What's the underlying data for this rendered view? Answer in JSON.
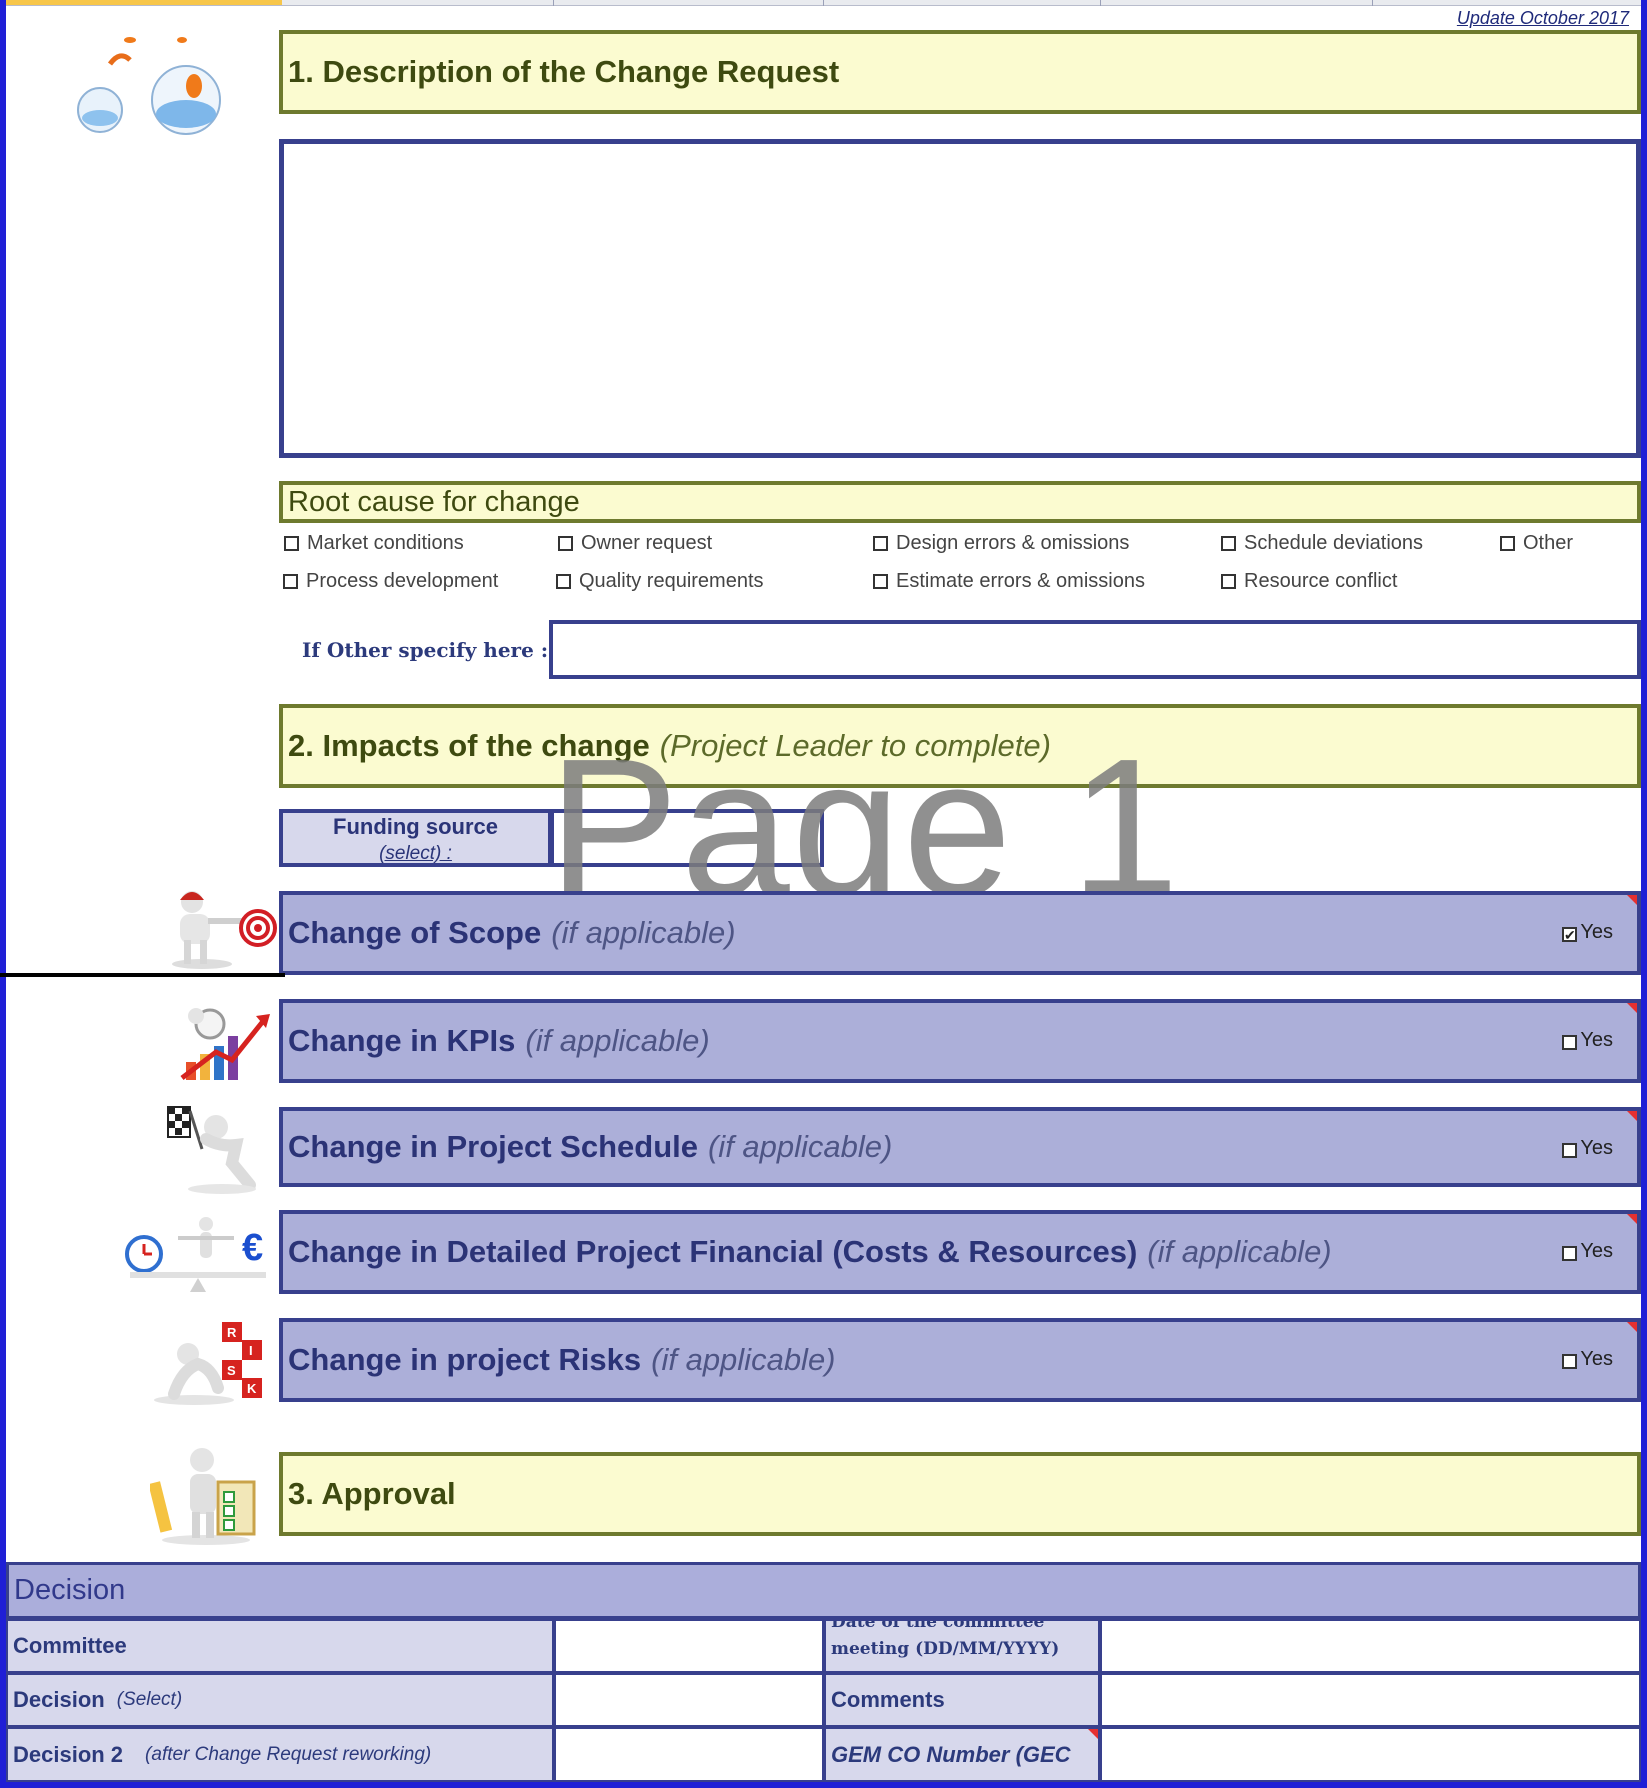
{
  "header": {
    "update_label": "Update October 2017"
  },
  "section1": {
    "title": "1. Description of the Change Request"
  },
  "root_cause": {
    "title": "Root cause for change",
    "options": [
      "Market conditions",
      "Owner request",
      "Design errors & omissions",
      "Schedule deviations",
      "Other",
      "Process development",
      "Quality requirements",
      "Estimate errors & omissions",
      "Resource conflict"
    ],
    "other_label": "If Other specify here :"
  },
  "section2": {
    "title": "2. Impacts of the change",
    "subtitle": "(Project Leader to complete)"
  },
  "watermark": "Page 1",
  "funding": {
    "label": "Funding source",
    "select_hint": "(select) :"
  },
  "impacts": [
    {
      "title": "Change of Scope",
      "subtitle": "(if applicable)",
      "yes_label": "Yes",
      "checked": true,
      "icon": "scope-target-icon"
    },
    {
      "title": "Change in KPIs",
      "subtitle": "(if applicable)",
      "yes_label": "Yes",
      "checked": false,
      "icon": "kpi-chart-icon"
    },
    {
      "title": "Change in Project Schedule",
      "subtitle": "(if applicable)",
      "yes_label": "Yes",
      "checked": false,
      "icon": "checkered-flag-icon"
    },
    {
      "title": "Change in Detailed Project Financial (Costs & Resources)",
      "subtitle": "(if applicable)",
      "yes_label": "Yes",
      "checked": false,
      "icon": "clock-euro-balance-icon"
    },
    {
      "title": "Change in project Risks",
      "subtitle": "(if applicable)",
      "yes_label": "Yes",
      "checked": false,
      "icon": "risk-blocks-icon"
    }
  ],
  "section3": {
    "title": "3. Approval"
  },
  "decision": {
    "title": "Decision",
    "rows": [
      {
        "label": "Committee",
        "hint": "",
        "right_label": "Date of the committee meeting (DD/MM/YYYY)"
      },
      {
        "label": "Decision",
        "hint": "(Select)",
        "right_label": "Comments"
      },
      {
        "label": "Decision 2",
        "hint": "(after Change Request reworking)",
        "right_label": "GEM CO Number (GEC"
      }
    ]
  },
  "colors": {
    "border_blue": "#1f1fd6",
    "yellow_header": "#fbfbd0",
    "purple_header": "#acafd9",
    "navy": "#38408d"
  }
}
